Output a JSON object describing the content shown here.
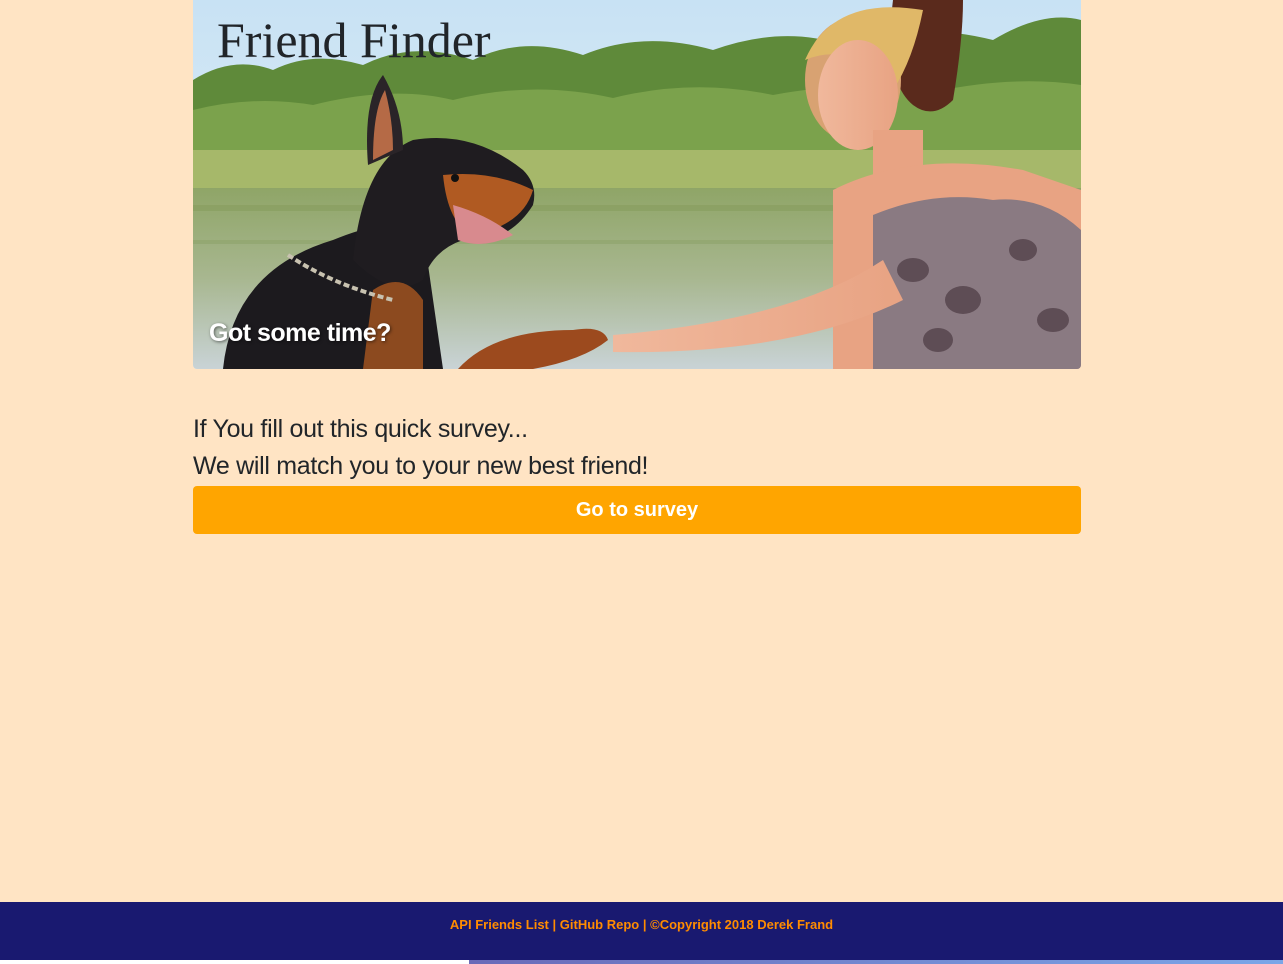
{
  "hero": {
    "title": "Friend Finder",
    "tagline": "Got some time?"
  },
  "pitch": {
    "line1": "If You fill out this quick survey...",
    "line2": "We will match you to your new best friend!"
  },
  "survey_button": {
    "label": "Go to survey"
  },
  "footer": {
    "link_api": "API Friends List",
    "separator": "|",
    "link_github": "GitHub Repo",
    "copyright": "©Copyright 2018 Derek Frand"
  },
  "colors": {
    "page_background": "#ffe4c4",
    "button": "#ffa500",
    "footer_background": "#191970",
    "footer_text": "#ff8c00"
  }
}
